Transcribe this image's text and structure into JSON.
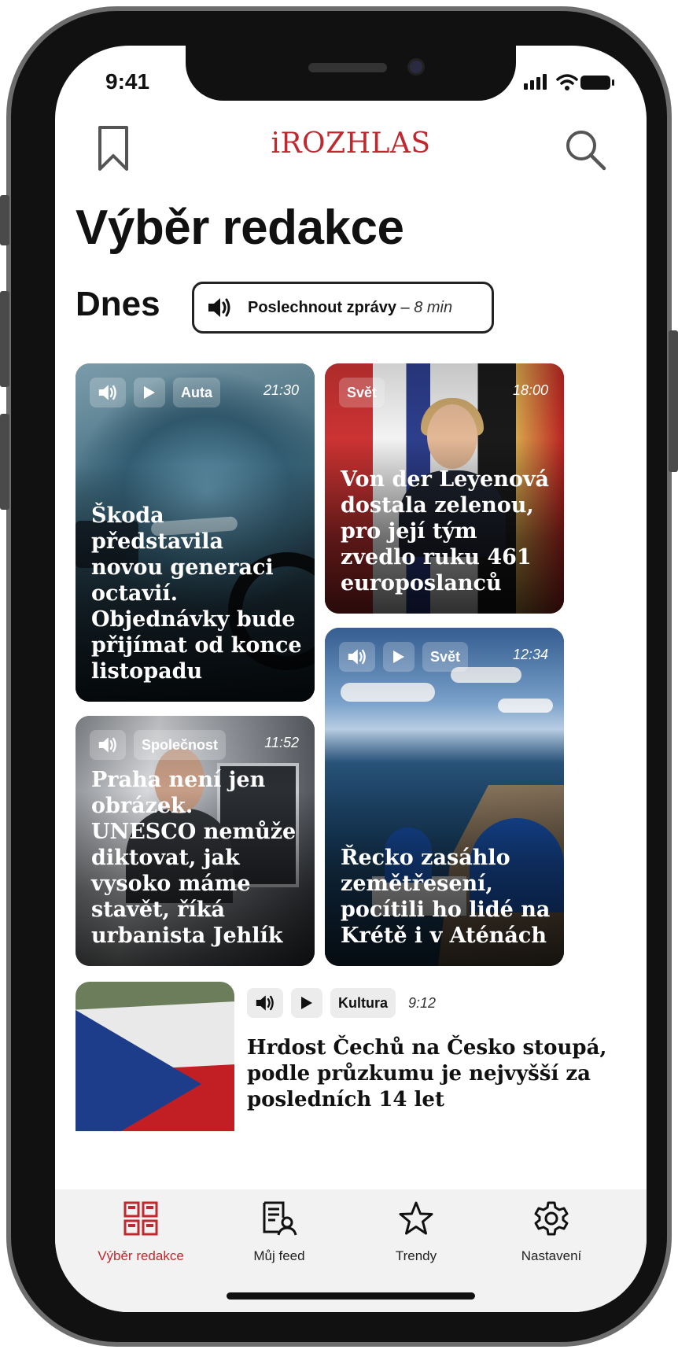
{
  "status_bar": {
    "time": "9:41"
  },
  "header": {
    "logo": "iROZHLAS",
    "bookmark_icon": "bookmark-icon",
    "search_icon": "search-icon"
  },
  "page": {
    "title": "Výběr redakce"
  },
  "today": {
    "label": "Dnes",
    "listen": {
      "label": "Poslechnout zprávy",
      "separator": "–",
      "duration": "8 min"
    }
  },
  "articles": [
    {
      "category": "Auta",
      "time": "21:30",
      "headline": "Škoda představila novou generaci octavií. Objednávky bude přijímat od konce listopadu",
      "has_audio": true,
      "has_video": true
    },
    {
      "category": "Svět",
      "time": "18:00",
      "headline": "Von der Leyenová dostala zelenou, pro její tým zvedlo ruku 461 europoslanců",
      "has_audio": false,
      "has_video": false
    },
    {
      "category": "Svět",
      "time": "12:34",
      "headline": "Řecko zasáhlo zemětřesení, pocítili ho lidé na Krétě i v Aténách",
      "has_audio": true,
      "has_video": true
    },
    {
      "category": "Společnost",
      "time": "11:52",
      "headline": "Praha není jen obrázek. UNESCO nemůže diktovat, jak vysoko máme stavět, říká urbanista Jehlík",
      "has_audio": true,
      "has_video": false
    },
    {
      "category": "Kultura",
      "time": "9:12",
      "headline": "Hrdost Čechů na Česko stoupá, podle průzkumu je nejvyšší za posledních 14 let",
      "has_audio": true,
      "has_video": true
    }
  ],
  "tabbar": {
    "items": [
      {
        "label": "Výběr redakce",
        "icon": "grid-icon",
        "active": true
      },
      {
        "label": "Můj feed",
        "icon": "feed-user-icon",
        "active": false
      },
      {
        "label": "Trendy",
        "icon": "star-icon",
        "active": false
      },
      {
        "label": "Nastavení",
        "icon": "gear-icon",
        "active": false
      }
    ]
  },
  "colors": {
    "brand": "#c0282f",
    "text": "#111111",
    "tabbar_bg": "#f2f2f2"
  }
}
